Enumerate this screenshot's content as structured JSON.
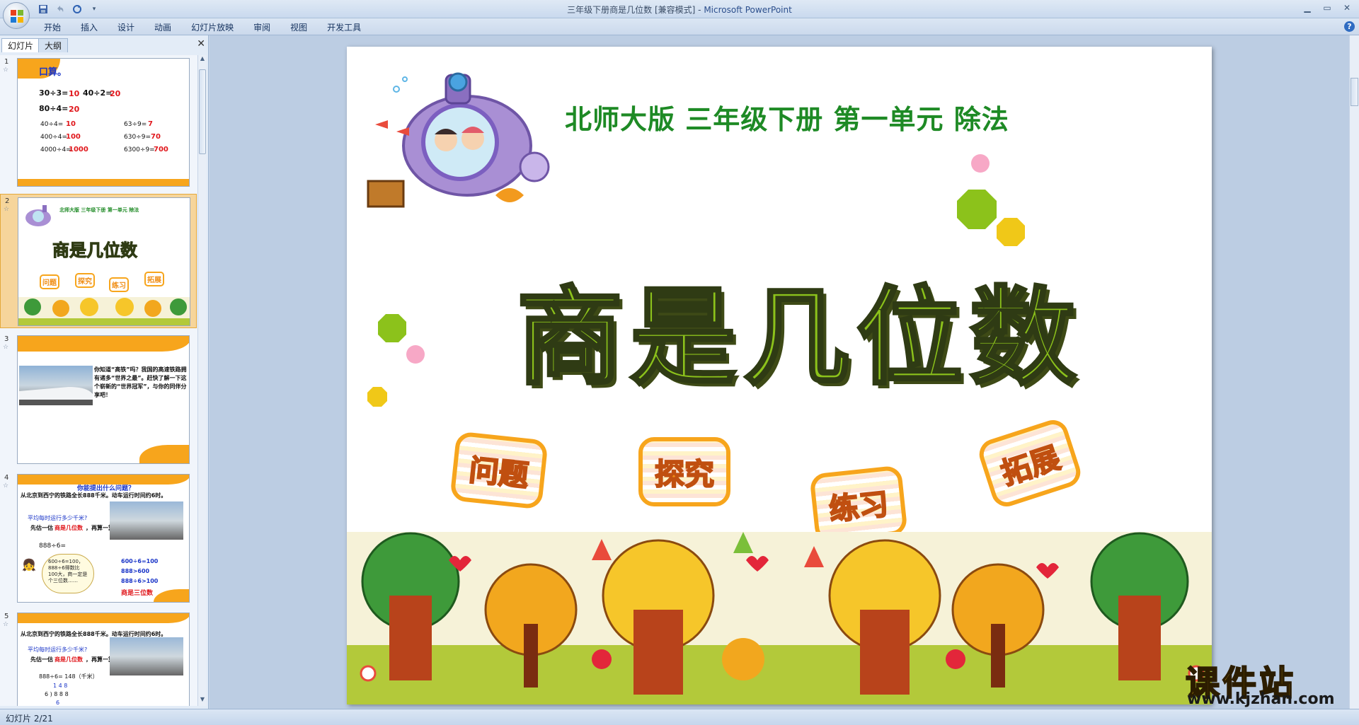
{
  "window": {
    "title": "三年级下册商是几位数 [兼容模式]",
    "title_sep": " - ",
    "app_name": "Microsoft PowerPoint"
  },
  "ribbon": {
    "tabs": [
      "开始",
      "插入",
      "设计",
      "动画",
      "幻灯片放映",
      "审阅",
      "视图",
      "开发工具"
    ]
  },
  "pane": {
    "tab_slides": "幻灯片",
    "tab_outline": "大纲",
    "close_glyph": "✕"
  },
  "thumbnails": [
    {
      "num": "1",
      "heading": "口算。",
      "rows": [
        [
          "30÷3=",
          "10",
          "40÷2=",
          "20"
        ],
        [
          "80÷4=",
          "20"
        ],
        [
          "40÷4=",
          "10",
          "63÷9=",
          "7"
        ],
        [
          "400÷4=",
          "100",
          "630÷9=",
          "70"
        ],
        [
          "4000÷4=",
          "1000",
          "6300÷9=",
          "700"
        ]
      ]
    },
    {
      "num": "2",
      "subtitle": "北师大版  三年级下册  第一单元  除法",
      "title": "商是几位数",
      "badges": [
        "问题",
        "探究",
        "练习",
        "拓展"
      ]
    },
    {
      "num": "3",
      "text": "你知道“高铁”吗？我国的高速铁路拥有诸多“世界之最”。赶快了解一下这个崭新的“世界冠军”，与你的同伴分享吧！"
    },
    {
      "num": "4",
      "heading": "你能提出什么问题？",
      "line1": "从北京到西宁的铁路全长888千米。动车运行时间约6时。",
      "q": "平均每时运行多少千米?",
      "hint_a": "先估一估",
      "hint_b": "商是几位数",
      "hint_c": "，再算一算。",
      "expr": "888÷6=",
      "bubble": "600÷6=100，888÷6得数比100大，商一定是个三位数……",
      "r1": "600÷6=100",
      "r2": "888>600",
      "r3": "888÷6>100",
      "r4": "商是三位数"
    },
    {
      "num": "5",
      "line1": "从北京到西宁的铁路全长888千米。动车运行时间约6时。",
      "q": "平均每时运行多少千米?",
      "hint_a": "先估一估",
      "hint_b": "商是几位数",
      "hint_c": "，再算一算。",
      "expr": "888÷6= 148（千米）",
      "quot": "1 4 8",
      "div": "6 ) 8 8 8",
      "sub": "6"
    }
  ],
  "slide": {
    "subtitle": "北师大版  三年级下册  第一单元  除法",
    "title": "商是几位数",
    "badges": [
      "问题",
      "探究",
      "练习",
      "拓展"
    ]
  },
  "status": {
    "slide_counter": "幻灯片 2/21"
  },
  "watermark": {
    "cn": "课件站",
    "url": "www.kjzhan.com"
  },
  "colors": {
    "title_green": "#8cc21b",
    "subtitle_green": "#1e8a25",
    "badge_orange": "#f7a51c",
    "selected_thumb": "#f6d59b"
  }
}
